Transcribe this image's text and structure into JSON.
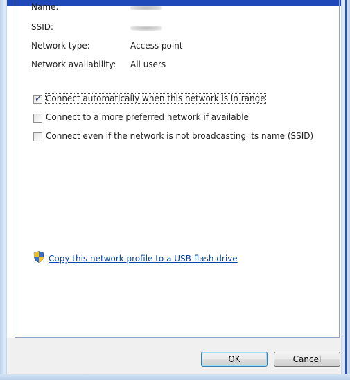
{
  "properties": {
    "name_label": "Name:",
    "ssid_label": "SSID:",
    "network_type_label": "Network type:",
    "network_type_value": "Access point",
    "availability_label": "Network availability:",
    "availability_value": "All users"
  },
  "options": [
    {
      "label": "Connect automatically when this network is in range",
      "checked": true
    },
    {
      "label": "Connect to a more preferred network if available",
      "checked": false
    },
    {
      "label": "Connect even if the network is not broadcasting its name (SSID)",
      "checked": false
    }
  ],
  "checkmark_glyph": "✓",
  "link": {
    "label": "Copy this network profile to a USB flash drive",
    "icon": "uac-shield-icon"
  },
  "buttons": {
    "ok": "OK",
    "cancel": "Cancel"
  },
  "colors": {
    "title_band": "#1f49b8",
    "link": "#0645ad"
  }
}
